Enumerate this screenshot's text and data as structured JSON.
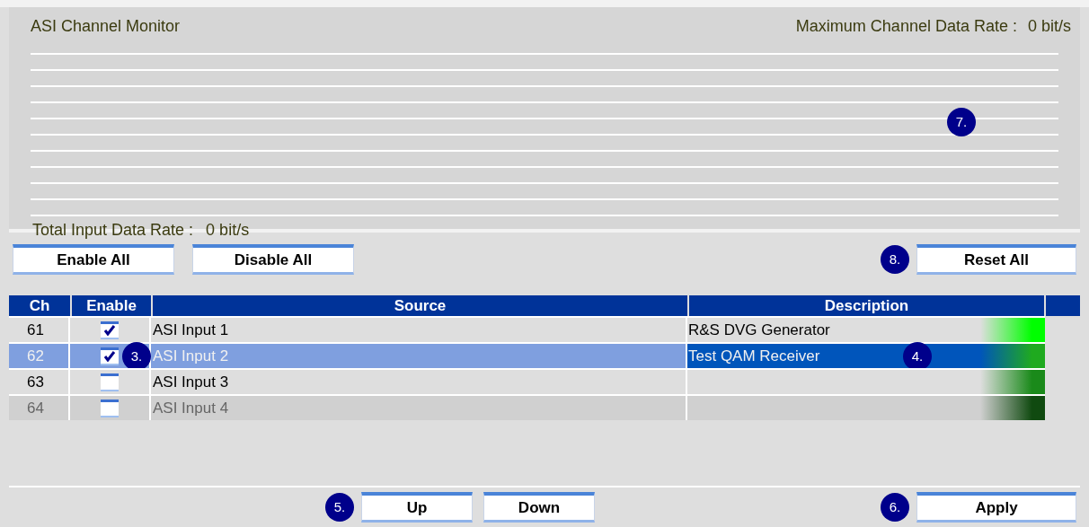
{
  "monitor": {
    "title": "ASI Channel Monitor",
    "max_rate_label": "Maximum Channel Data Rate :",
    "max_rate_value": "0 bit/s",
    "total_rate_label": "Total Input Data Rate :",
    "total_rate_value": "0 bit/s",
    "callout": "7."
  },
  "top_buttons": [
    {
      "label": "Enable All"
    },
    {
      "label": "Disable All"
    }
  ],
  "reset_button": {
    "label": "Reset All",
    "callout": "8."
  },
  "table": {
    "columns": [
      "Ch",
      "Enable",
      "Source",
      "Description"
    ],
    "rows": [
      {
        "ch": "61",
        "enabled": true,
        "source": "ASI Input 1",
        "description": "R&S DVG Generator",
        "selected": false,
        "disabled": false,
        "color": "#00ff00"
      },
      {
        "ch": "62",
        "enabled": true,
        "source": "ASI Input 2",
        "description": "Test QAM Receiver",
        "selected": true,
        "disabled": false,
        "color": "#1faa1f",
        "enable_callout": "3.",
        "description_callout": "4."
      },
      {
        "ch": "63",
        "enabled": false,
        "source": "ASI Input 3",
        "description": "",
        "selected": false,
        "disabled": false,
        "color": "#1a8a1a"
      },
      {
        "ch": "64",
        "enabled": false,
        "source": "ASI Input 4",
        "description": "",
        "selected": false,
        "disabled": true,
        "color": "#104a10"
      }
    ]
  },
  "bottom_buttons": [
    {
      "label": "Up",
      "callout": "5."
    },
    {
      "label": "Down"
    }
  ],
  "apply_button": {
    "label": "Apply",
    "callout": "6."
  }
}
